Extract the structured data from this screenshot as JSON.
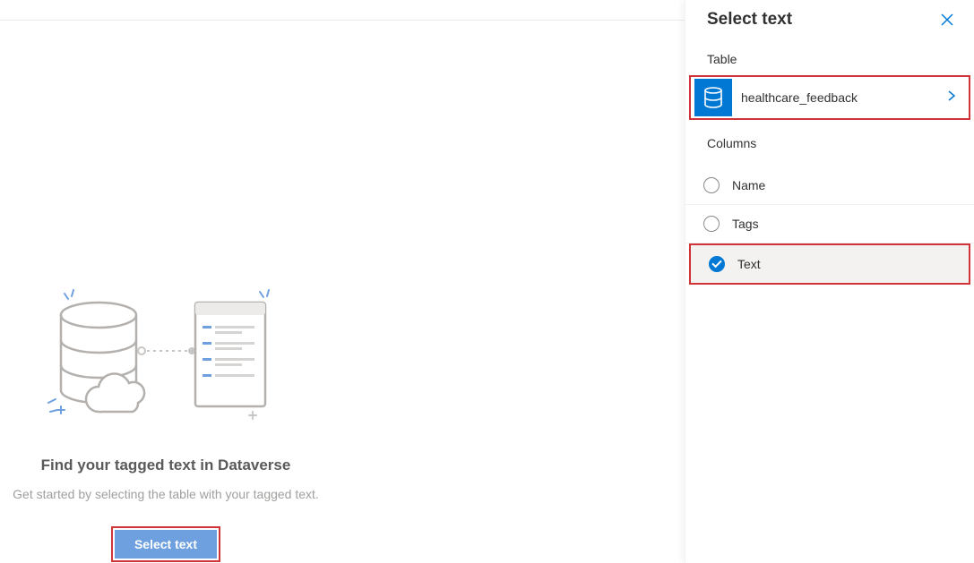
{
  "main": {
    "heading": "Find your tagged text in Dataverse",
    "subtext": "Get started by selecting the table with your tagged text.",
    "button_label": "Select text"
  },
  "panel": {
    "title": "Select text",
    "table_section_label": "Table",
    "table_name": "healthcare_feedback",
    "columns_section_label": "Columns",
    "columns": [
      {
        "label": "Name",
        "selected": false
      },
      {
        "label": "Tags",
        "selected": false
      },
      {
        "label": "Text",
        "selected": true
      }
    ]
  },
  "icons": {
    "close": "close-icon",
    "database": "database-icon",
    "chevron_right": "chevron-right-icon"
  },
  "colors": {
    "primary": "#0078d4",
    "highlight_border": "#d13438",
    "button_bg": "#6ea0e0",
    "text_muted": "#a19f9d"
  }
}
